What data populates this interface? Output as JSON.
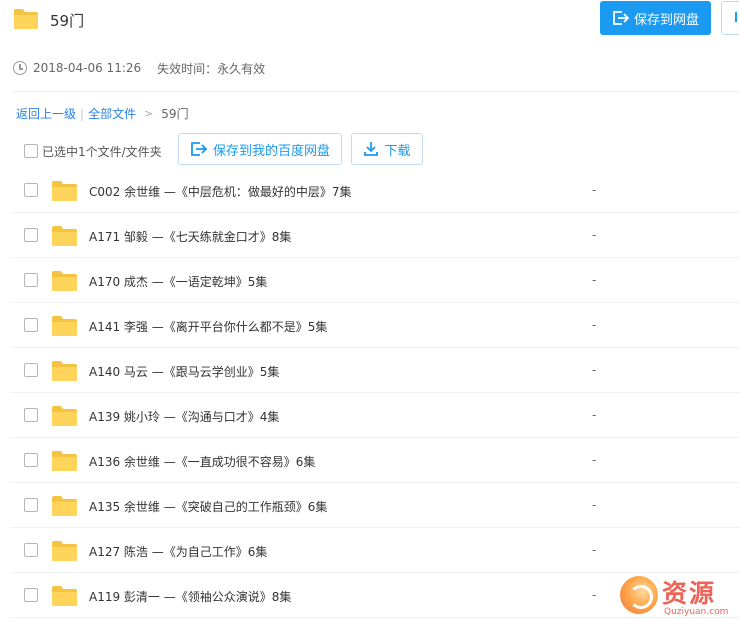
{
  "header": {
    "title": "59门",
    "save_to_netdisk_label": "保存到网盘",
    "accent_color": "#1a9af0"
  },
  "meta": {
    "created": "2018-04-06 11:26",
    "expire": "失效时间：永久有效"
  },
  "breadcrumb": {
    "back": "返回上一级",
    "all_files": "全部文件",
    "current": "59门"
  },
  "toolbar": {
    "selection_label": "已选中1个文件/文件夹",
    "save_to_baidu_label": "保存到我的百度网盘",
    "download_label": "下载"
  },
  "files": [
    {
      "name": "C002 余世维 —《中层危机：做最好的中层》7集",
      "size": "-"
    },
    {
      "name": "A171 邹毅 —《七天练就金口才》8集",
      "size": "-"
    },
    {
      "name": "A170 成杰 —《一语定乾坤》5集",
      "size": "-"
    },
    {
      "name": "A141 李强 —《离开平台你什么都不是》5集",
      "size": "-"
    },
    {
      "name": "A140 马云 —《跟马云学创业》5集",
      "size": "-"
    },
    {
      "name": "A139 姚小玲 —《沟通与口才》4集",
      "size": "-"
    },
    {
      "name": "A136 余世维 —《一直成功很不容易》6集",
      "size": "-"
    },
    {
      "name": "A135 余世维 —《突破自己的工作瓶颈》6集",
      "size": "-"
    },
    {
      "name": "A127 陈浩 —《为自己工作》6集",
      "size": "-"
    },
    {
      "name": "A119 彭清一 —《领袖公众演说》8集",
      "size": "-"
    }
  ],
  "watermark": {
    "text": "资源",
    "sub": "Quziyuan.com"
  },
  "icons": {
    "folder": "folder-icon",
    "clock": "clock-icon",
    "save": "save-to-netdisk-icon",
    "download": "download-icon"
  }
}
